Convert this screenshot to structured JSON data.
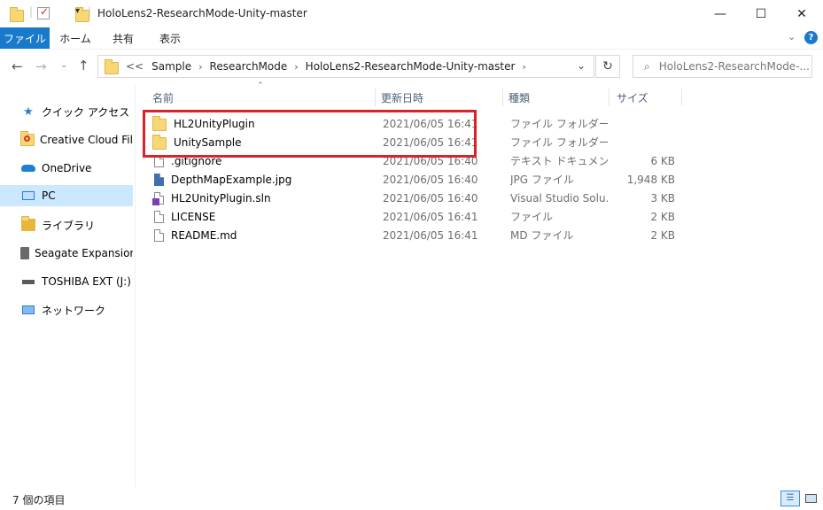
{
  "window": {
    "title": "HoloLens2-ResearchMode-Unity-master",
    "controls": {
      "minimize": "—",
      "maximize": "☐",
      "close": "✕"
    }
  },
  "ribbon": {
    "tabs": [
      "ファイル",
      "ホーム",
      "共有",
      "表示"
    ]
  },
  "address": {
    "overflow": "<<",
    "breadcrumbs": [
      "Sample",
      "ResearchMode",
      "HoloLens2-ResearchMode-Unity-master"
    ]
  },
  "search": {
    "placeholder": "HoloLens2-ResearchMode-..."
  },
  "nav": {
    "items": [
      {
        "label": "クイック アクセス",
        "icon": "star-icon"
      },
      {
        "label": "Creative Cloud Files",
        "icon": "creative-cloud-icon"
      },
      {
        "label": "OneDrive",
        "icon": "cloud-icon"
      },
      {
        "label": "PC",
        "icon": "pc-icon"
      },
      {
        "label": "ライブラリ",
        "icon": "library-icon"
      },
      {
        "label": "Seagate Expansion D",
        "icon": "drive-icon"
      },
      {
        "label": "TOSHIBA EXT (J:)",
        "icon": "usb-drive-icon"
      },
      {
        "label": "ネットワーク",
        "icon": "network-icon"
      }
    ]
  },
  "columns": {
    "name": "名前",
    "date": "更新日時",
    "type": "種類",
    "size": "サイズ"
  },
  "files": [
    {
      "name": "HL2UnityPlugin",
      "date": "2021/06/05 16:41",
      "type": "ファイル フォルダー",
      "size": "",
      "icon": "folder-icon"
    },
    {
      "name": "UnitySample",
      "date": "2021/06/05 16:41",
      "type": "ファイル フォルダー",
      "size": "",
      "icon": "folder-icon"
    },
    {
      "name": ".gitignore",
      "date": "2021/06/05 16:40",
      "type": "テキスト ドキュメント",
      "size": "6 KB",
      "icon": "text-file-icon"
    },
    {
      "name": "DepthMapExample.jpg",
      "date": "2021/06/05 16:40",
      "type": "JPG ファイル",
      "size": "1,948 KB",
      "icon": "image-file-icon"
    },
    {
      "name": "HL2UnityPlugin.sln",
      "date": "2021/06/05 16:40",
      "type": "Visual Studio Solu...",
      "size": "3 KB",
      "icon": "vs-solution-icon"
    },
    {
      "name": "LICENSE",
      "date": "2021/06/05 16:41",
      "type": "ファイル",
      "size": "2 KB",
      "icon": "file-icon"
    },
    {
      "name": "README.md",
      "date": "2021/06/05 16:41",
      "type": "MD ファイル",
      "size": "2 KB",
      "icon": "file-icon"
    }
  ],
  "status": {
    "item_count": "7 個の項目"
  },
  "colors": {
    "accent": "#1979ca",
    "selection": "#cce8ff",
    "highlight_box": "#d9232b"
  }
}
